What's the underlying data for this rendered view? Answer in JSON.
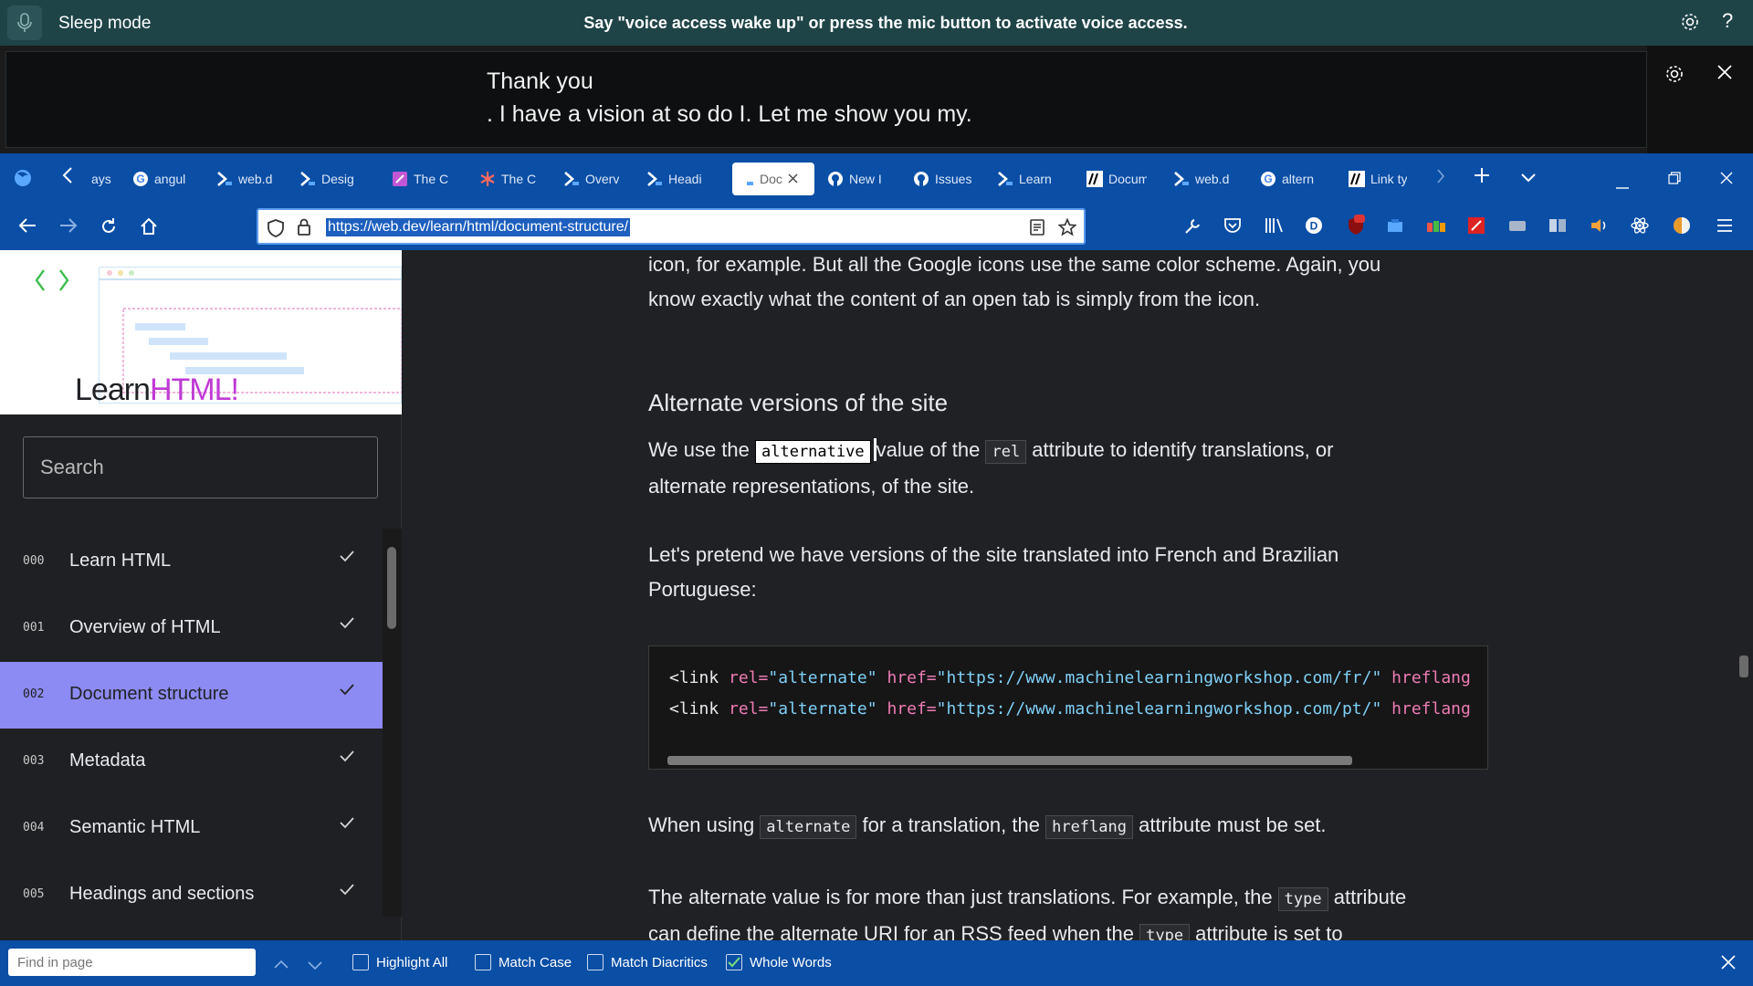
{
  "voice_access": {
    "mode": "Sleep mode",
    "message": "Say \"voice access wake up\" or press the mic button to activate voice access.",
    "help": "?"
  },
  "captions": {
    "line1": "Thank you",
    "line2": ". I have a vision at so do I. Let me show you my."
  },
  "tabs": [
    {
      "label": "ays",
      "icon": "page-icon"
    },
    {
      "label": "angul",
      "icon": "google-icon"
    },
    {
      "label": "web.d",
      "icon": "webdev-icon"
    },
    {
      "label": "Desig",
      "icon": "webdev-icon"
    },
    {
      "label": "The C",
      "icon": "css-icon"
    },
    {
      "label": "The C",
      "icon": "asterisk-icon"
    },
    {
      "label": "Overv",
      "icon": "webdev-icon"
    },
    {
      "label": "Headi",
      "icon": "webdev-icon"
    },
    {
      "label": "Doc",
      "icon": "webdev-icon",
      "active": true
    },
    {
      "label": "New I",
      "icon": "github-icon"
    },
    {
      "label": "Issues",
      "icon": "github-icon"
    },
    {
      "label": "Learn",
      "icon": "webdev-icon"
    },
    {
      "label": "Docum",
      "icon": "mdn-icon"
    },
    {
      "label": "web.d",
      "icon": "webdev-icon"
    },
    {
      "label": "altern",
      "icon": "google-icon"
    },
    {
      "label": "Link ty",
      "icon": "mdn-icon"
    }
  ],
  "url": "https://web.dev/learn/html/document-structure/",
  "logo": {
    "part1": "Learn",
    "part2": "HTML!"
  },
  "search": {
    "placeholder": "Search"
  },
  "nav": [
    {
      "num": "000",
      "label": "Learn HTML"
    },
    {
      "num": "001",
      "label": "Overview of HTML"
    },
    {
      "num": "002",
      "label": "Document structure",
      "active": true
    },
    {
      "num": "003",
      "label": "Metadata"
    },
    {
      "num": "004",
      "label": "Semantic HTML"
    },
    {
      "num": "005",
      "label": "Headings and sections"
    }
  ],
  "content": {
    "intro_line1": "icon, for example. But all the Google icons use the same color scheme. Again, you",
    "intro_line2": "know exactly what the content of an open tab is simply from the icon.",
    "heading": "Alternate versions of the site",
    "p1_a": "We use the ",
    "p1_code1": "alternative",
    "p1_b": "value of the ",
    "p1_code2": "rel",
    "p1_c": " attribute to identify translations, or",
    "p1_d": "alternate representations, of the site.",
    "p2_a": "Let's pretend we have versions of the site translated into French and Brazilian",
    "p2_b": "Portuguese:",
    "code_lines": [
      {
        "tag": "<link",
        "attr1": "rel=",
        "val1": "\"alternate\"",
        "attr2": "href=",
        "val2": "\"https://www.machinelearningworkshop.com/fr/\"",
        "attr3": "hreflang"
      },
      {
        "tag": "<link",
        "attr1": "rel=",
        "val1": "\"alternate\"",
        "attr2": "href=",
        "val2": "\"https://www.machinelearningworkshop.com/pt/\"",
        "attr3": "hreflang"
      }
    ],
    "p3_a": "When using ",
    "p3_code1": "alternate",
    "p3_b": " for a translation, the ",
    "p3_code2": "hreflang",
    "p3_c": " attribute must be set.",
    "p4_a": "The alternate value is for more than just translations. For example, the ",
    "p4_code1": "type",
    "p4_b": " attribute",
    "p4_c": "can define the alternate URI for an RSS feed when the ",
    "p4_code2": "type",
    "p4_d": " attribute is set to"
  },
  "findbar": {
    "placeholder": "Find in page",
    "options": [
      {
        "label": "Highlight All",
        "checked": false
      },
      {
        "label": "Match Case",
        "checked": false
      },
      {
        "label": "Match Diacritics",
        "checked": false
      },
      {
        "label": "Whole Words",
        "checked": true
      }
    ]
  }
}
